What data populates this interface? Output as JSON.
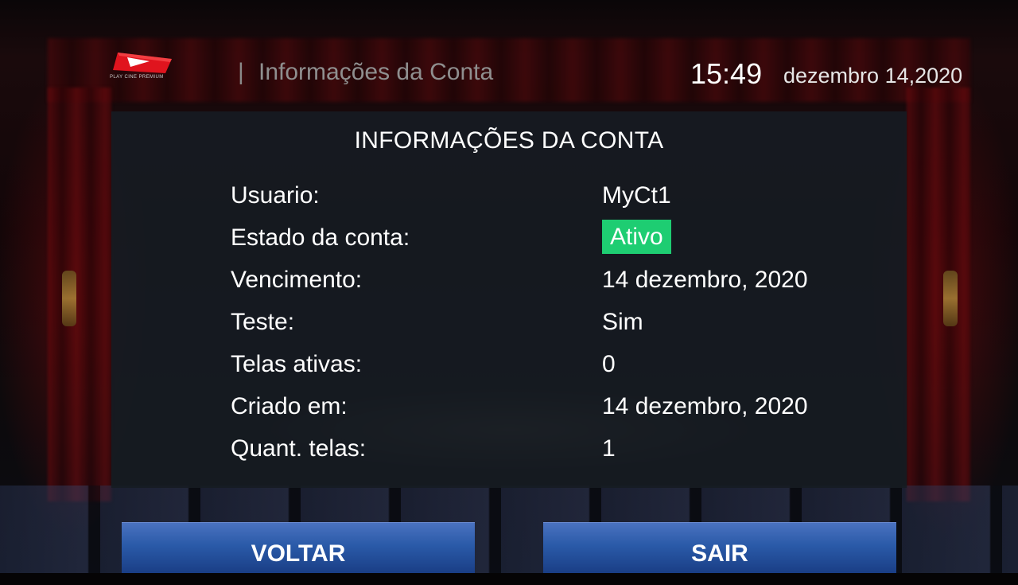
{
  "header": {
    "logo_text": "PLAY CINE PREMIUM",
    "divider": "|",
    "title": "Informações da Conta",
    "time": "15:49",
    "date": "dezembro 14,2020"
  },
  "panel": {
    "title": "INFORMAÇÕES DA CONTA",
    "rows": [
      {
        "label": "Usuario:",
        "value": "MyCt1"
      },
      {
        "label": "Estado da conta:",
        "value": "Ativo"
      },
      {
        "label": "Vencimento:",
        "value": "14 dezembro, 2020"
      },
      {
        "label": "Teste:",
        "value": "Sim"
      },
      {
        "label": "Telas ativas:",
        "value": "0"
      },
      {
        "label": "Criado em:",
        "value": "14 dezembro, 2020"
      },
      {
        "label": "Quant. telas:",
        "value": "1"
      }
    ]
  },
  "buttons": {
    "back_label": "VOLTAR",
    "exit_label": "SAIR"
  },
  "colors": {
    "status_active": "#1ecd72",
    "button_blue": "#2a5aa8",
    "logo_red": "#e0141e"
  }
}
